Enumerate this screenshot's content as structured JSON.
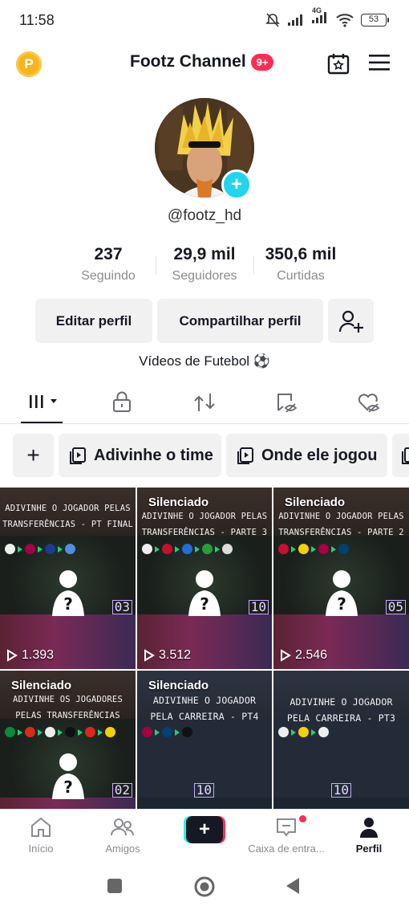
{
  "status_bar": {
    "time": "11:58",
    "network": "4G",
    "battery": "53"
  },
  "header": {
    "coin_letter": "P",
    "title": "Footz Channel",
    "notification_badge": "9+"
  },
  "profile": {
    "username": "@footz_hd",
    "stats": [
      {
        "value": "237",
        "label": "Seguindo"
      },
      {
        "value": "29,9 mil",
        "label": "Seguidores"
      },
      {
        "value": "350,6 mil",
        "label": "Curtidas"
      }
    ],
    "buttons": {
      "edit": "Editar perfil",
      "share": "Compartilhar perfil"
    },
    "bio": "Vídeos de Futebol ⚽"
  },
  "tabs": [
    "videos",
    "private",
    "reposts",
    "favorites",
    "liked"
  ],
  "playlists": {
    "add": "+",
    "items": [
      "Adivinhe o time",
      "Onde ele jogou"
    ]
  },
  "videos": [
    {
      "caption1": "ADIVINHE O JOGADOR PELAS",
      "caption2": "TRANSFERÊNCIAS - PT FINAL",
      "silenced": "",
      "number": "03",
      "views": "1.393"
    },
    {
      "caption1": "ADIVINHE O JOGADOR PELAS",
      "caption2": "TRANSFERÊNCIAS - PARTE 3",
      "silenced": "Silenciado",
      "number": "10",
      "views": "3.512"
    },
    {
      "caption1": "ADIVINHE O JOGADOR PELAS",
      "caption2": "TRANSFERÊNCIAS - PARTE 2",
      "silenced": "Silenciado",
      "number": "05",
      "views": "2.546"
    },
    {
      "caption1": "ADIVINHE OS JOGADORES",
      "caption2": "PELAS TRANSFERÊNCIAS",
      "silenced": "Silenciado",
      "number": "02",
      "views": ""
    },
    {
      "caption1": "ADIVINHE O JOGADOR",
      "caption2": "PELA CARREIRA - PT4",
      "silenced": "Silenciado",
      "number": "10",
      "views": ""
    },
    {
      "caption1": "ADIVINHE O JOGADOR",
      "caption2": "PELA CARREIRA - PT3",
      "silenced": "",
      "number": "10",
      "views": ""
    }
  ],
  "bottom_nav": [
    {
      "label": "Início"
    },
    {
      "label": "Amigos"
    },
    {
      "label": "Caixa de entra..."
    },
    {
      "label": "Perfil"
    }
  ],
  "colors": {
    "accent_red": "#fe2c55",
    "accent_cyan": "#20d5ec",
    "text_primary": "#161823",
    "text_secondary": "#8a8b91",
    "button_bg": "#f1f1f2"
  }
}
